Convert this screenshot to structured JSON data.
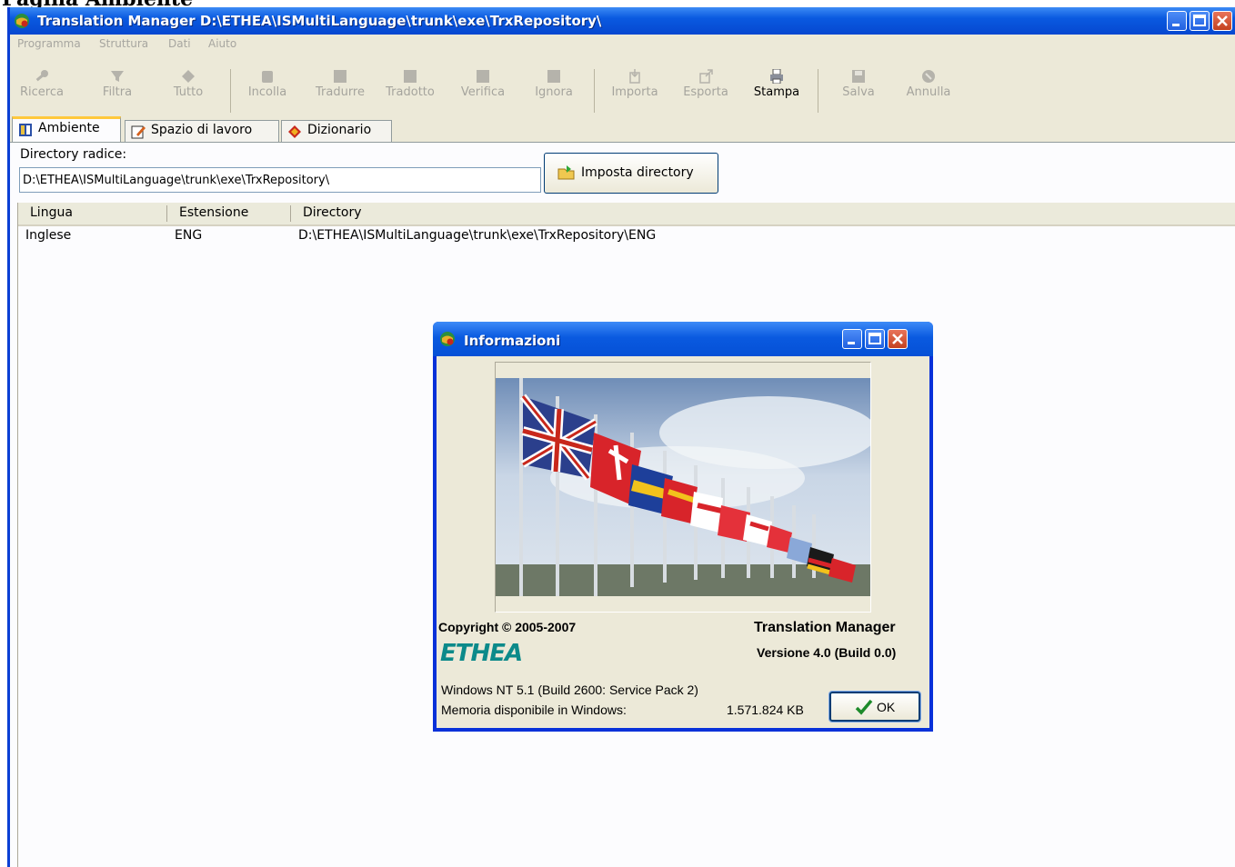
{
  "page_heading": "Pagina Ambiente",
  "window": {
    "title": "Translation Manager D:\\ETHEA\\ISMultiLanguage\\trunk\\exe\\TrxRepository\\"
  },
  "menu": [
    "Programma",
    "Struttura",
    "Dati",
    "Aiuto"
  ],
  "toolbar": [
    {
      "label": "Ricerca",
      "icon": "key-icon",
      "enabled": false
    },
    {
      "label": "Filtra",
      "icon": "filter-icon",
      "enabled": false
    },
    {
      "label": "Tutto",
      "icon": "all-icon",
      "enabled": false
    },
    {
      "label": "Incolla",
      "icon": "paste-icon",
      "enabled": false
    },
    {
      "label": "Tradurre",
      "icon": "translate-icon",
      "enabled": false
    },
    {
      "label": "Tradotto",
      "icon": "translated-icon",
      "enabled": false
    },
    {
      "label": "Verifica",
      "icon": "verify-icon",
      "enabled": false
    },
    {
      "label": "Ignora",
      "icon": "ignore-icon",
      "enabled": false
    },
    {
      "label": "Importa",
      "icon": "import-icon",
      "enabled": false
    },
    {
      "label": "Esporta",
      "icon": "export-icon",
      "enabled": false
    },
    {
      "label": "Stampa",
      "icon": "printer-icon",
      "enabled": true
    },
    {
      "label": "Salva",
      "icon": "save-icon",
      "enabled": false
    },
    {
      "label": "Annulla",
      "icon": "cancel-icon",
      "enabled": false
    }
  ],
  "tabs": [
    {
      "label": "Ambiente",
      "icon": "environment-icon",
      "selected": true
    },
    {
      "label": "Spazio di lavoro",
      "icon": "workspace-icon",
      "selected": false
    },
    {
      "label": "Dizionario",
      "icon": "dictionary-icon",
      "selected": false
    }
  ],
  "environment": {
    "root_label": "Directory radice:",
    "root_value": "D:\\ETHEA\\ISMultiLanguage\\trunk\\exe\\TrxRepository\\",
    "set_dir_label": "Imposta directory",
    "columns": [
      "Lingua",
      "Estensione",
      "Directory"
    ],
    "rows": [
      {
        "lingua": "Inglese",
        "estensione": "ENG",
        "directory": "D:\\ETHEA\\ISMultiLanguage\\trunk\\exe\\TrxRepository\\ENG"
      }
    ]
  },
  "about_dialog": {
    "title": "Informazioni",
    "copyright": "Copyright © 2005-2007",
    "product": "Translation Manager",
    "version": "Versione 4.0 (Build 0.0)",
    "logo_text": "ETHEA",
    "os": "Windows NT 5.1 (Build 2600: Service Pack 2)",
    "memory_label": "Memoria disponibile in Windows:",
    "memory_value": "1.571.824 KB",
    "ok_label": "OK"
  },
  "colors": {
    "titlebar": "#0a5ae0",
    "face": "#ece9d8",
    "tab_highlight": "#ffc83c",
    "logo": "#0c8a8a"
  }
}
